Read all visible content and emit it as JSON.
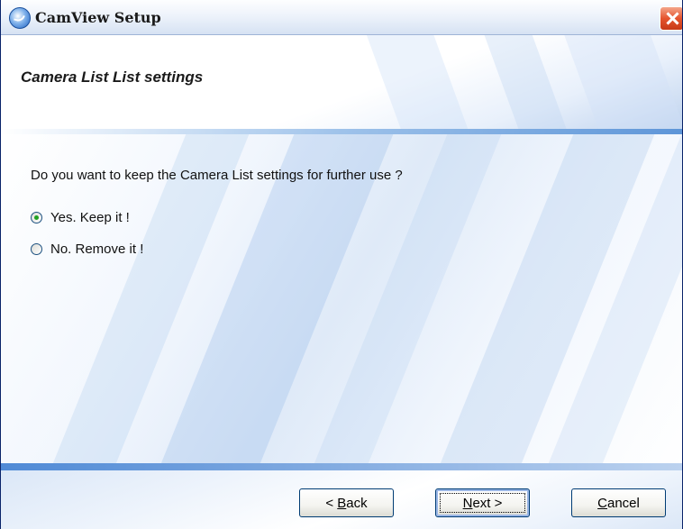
{
  "window": {
    "title": "CamView Setup",
    "close_icon": "close-icon",
    "app_icon": "camview-app-icon"
  },
  "header": {
    "title": "Camera List List settings"
  },
  "content": {
    "question": "Do you want to keep the Camera List settings for further use ?",
    "options": [
      {
        "label": "Yes. Keep it !",
        "checked": true
      },
      {
        "label": "No. Remove it !",
        "checked": false
      }
    ]
  },
  "footer": {
    "buttons": {
      "back": {
        "prefix": "< ",
        "mnemonic": "B",
        "rest": "ack"
      },
      "next": {
        "prefix": "",
        "mnemonic": "N",
        "rest": "ext >"
      },
      "cancel": {
        "prefix": "",
        "mnemonic": "C",
        "rest": "ancel"
      }
    }
  },
  "colors": {
    "accent": "#21a121",
    "close_button": "#e5542e",
    "border": "#003c74"
  }
}
